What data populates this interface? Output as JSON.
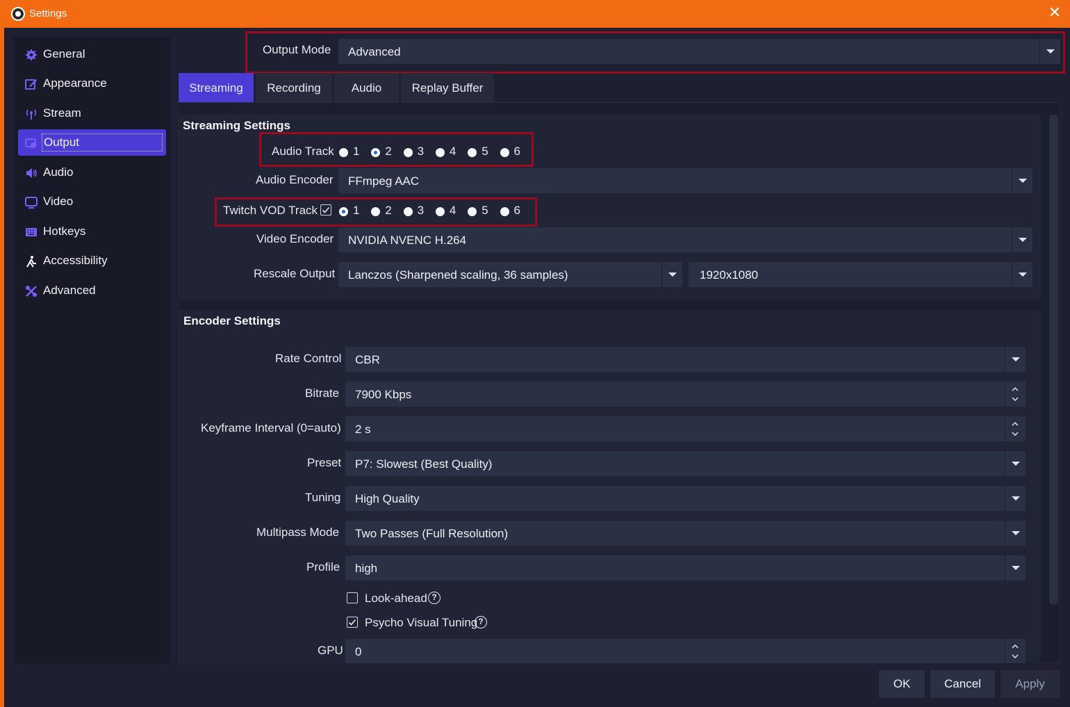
{
  "window": {
    "title": "Settings"
  },
  "sidebar": {
    "items": [
      {
        "label": "General"
      },
      {
        "label": "Appearance"
      },
      {
        "label": "Stream"
      },
      {
        "label": "Output",
        "active": true
      },
      {
        "label": "Audio"
      },
      {
        "label": "Video"
      },
      {
        "label": "Hotkeys"
      },
      {
        "label": "Accessibility"
      },
      {
        "label": "Advanced"
      }
    ]
  },
  "output_mode": {
    "label": "Output Mode",
    "value": "Advanced"
  },
  "tabs": [
    {
      "label": "Streaming",
      "active": true
    },
    {
      "label": "Recording"
    },
    {
      "label": "Audio"
    },
    {
      "label": "Replay Buffer"
    }
  ],
  "streaming": {
    "title": "Streaming Settings",
    "audio_track": {
      "label": "Audio Track",
      "options": [
        "1",
        "2",
        "3",
        "4",
        "5",
        "6"
      ],
      "selected": "2"
    },
    "audio_encoder": {
      "label": "Audio Encoder",
      "value": "FFmpeg AAC"
    },
    "twitch_vod": {
      "label": "Twitch VOD Track",
      "checked": true,
      "options": [
        "1",
        "2",
        "3",
        "4",
        "5",
        "6"
      ],
      "selected": "1"
    },
    "video_encoder": {
      "label": "Video Encoder",
      "value": "NVIDIA NVENC H.264"
    },
    "rescale": {
      "label": "Rescale Output",
      "filter": "Lanczos (Sharpened scaling, 36 samples)",
      "resolution": "1920x1080"
    }
  },
  "encoder": {
    "title": "Encoder Settings",
    "rate_control": {
      "label": "Rate Control",
      "value": "CBR"
    },
    "bitrate": {
      "label": "Bitrate",
      "value": "7900 Kbps"
    },
    "keyframe": {
      "label": "Keyframe Interval (0=auto)",
      "value": "2 s"
    },
    "preset": {
      "label": "Preset",
      "value": "P7: Slowest (Best Quality)"
    },
    "tuning": {
      "label": "Tuning",
      "value": "High Quality"
    },
    "multipass": {
      "label": "Multipass Mode",
      "value": "Two Passes (Full Resolution)"
    },
    "profile": {
      "label": "Profile",
      "value": "high"
    },
    "lookahead": {
      "label": "Look-ahead",
      "checked": false
    },
    "psycho": {
      "label": "Psycho Visual Tuning",
      "checked": true
    },
    "gpu": {
      "label": "GPU",
      "value": "0"
    }
  },
  "buttons": {
    "ok": "OK",
    "cancel": "Cancel",
    "apply": "Apply"
  },
  "colors": {
    "titlebar": "#f26b12",
    "accent": "#4d3bd6",
    "highlight_box": "#9a0b1f",
    "icon": "#7a5cff"
  }
}
